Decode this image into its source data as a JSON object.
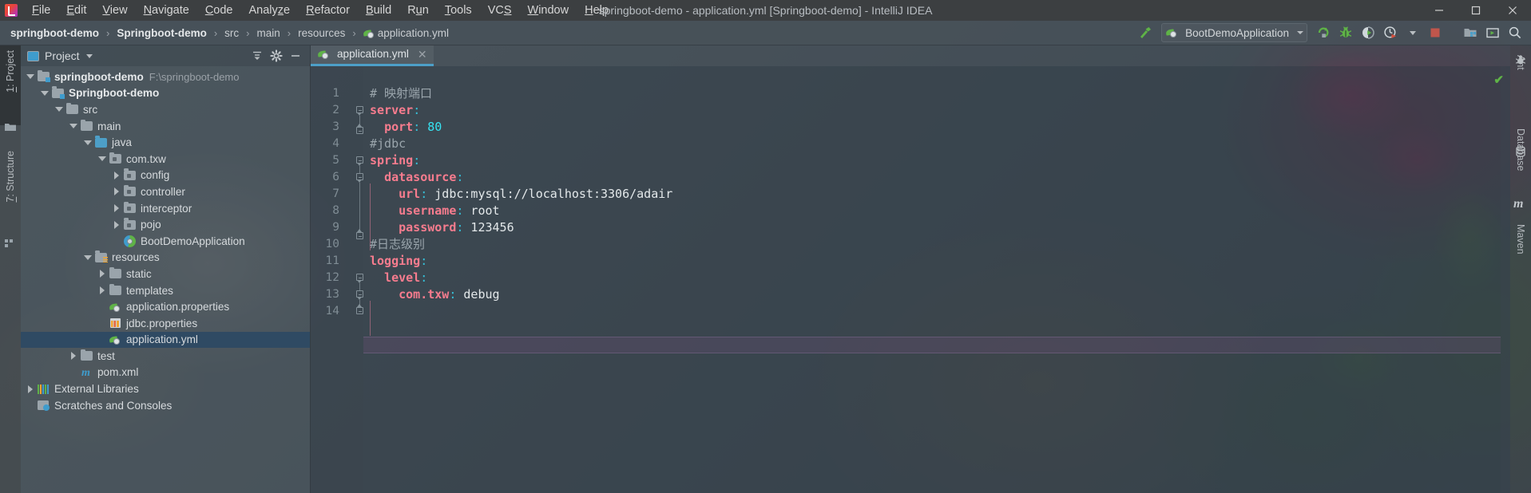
{
  "window": {
    "title": "springboot-demo - application.yml [Springboot-demo] - IntelliJ IDEA",
    "minimize_label": "─",
    "maximize_label": "❐",
    "close_label": "✕"
  },
  "menu": {
    "items": [
      {
        "label": "File",
        "mnemonic": "F"
      },
      {
        "label": "Edit",
        "mnemonic": "E"
      },
      {
        "label": "View",
        "mnemonic": "V"
      },
      {
        "label": "Navigate",
        "mnemonic": "N"
      },
      {
        "label": "Code",
        "mnemonic": "C"
      },
      {
        "label": "Analyze",
        "mnemonic": "z"
      },
      {
        "label": "Refactor",
        "mnemonic": "R"
      },
      {
        "label": "Build",
        "mnemonic": "B"
      },
      {
        "label": "Run",
        "mnemonic": "u"
      },
      {
        "label": "Tools",
        "mnemonic": "T"
      },
      {
        "label": "VCS",
        "mnemonic": "S"
      },
      {
        "label": "Window",
        "mnemonic": "W"
      },
      {
        "label": "Help",
        "mnemonic": "H"
      }
    ]
  },
  "breadcrumb": {
    "items": [
      {
        "label": "springboot-demo",
        "bold": true,
        "icon": ""
      },
      {
        "label": "Springboot-demo",
        "bold": true,
        "icon": ""
      },
      {
        "label": "src",
        "bold": false,
        "icon": ""
      },
      {
        "label": "main",
        "bold": false,
        "icon": ""
      },
      {
        "label": "resources",
        "bold": false,
        "icon": ""
      },
      {
        "label": "application.yml",
        "bold": false,
        "icon": "spring-yaml-icon"
      }
    ],
    "separator": "›"
  },
  "toolbar": {
    "build_icon": "hammer-icon",
    "run_config": {
      "name": "BootDemoApplication",
      "icon": "spring-boot-icon",
      "caret": "▾"
    },
    "buttons": [
      {
        "name": "run-button",
        "icon": "run-icon"
      },
      {
        "name": "debug-button",
        "icon": "debug-bug-icon"
      },
      {
        "name": "run-with-coverage-button",
        "icon": "coverage-icon"
      },
      {
        "name": "profiler-button",
        "icon": "profiler-clock-icon"
      },
      {
        "name": "profiler-dropdown",
        "icon": "chevron-down-icon"
      },
      {
        "name": "stop-button",
        "icon": "stop-square-icon"
      },
      {
        "name": "project-structure-button",
        "icon": "project-structure-icon"
      },
      {
        "name": "terminal-button",
        "icon": "terminal-icon"
      },
      {
        "name": "search-everywhere-button",
        "icon": "search-icon"
      }
    ]
  },
  "left_strip": {
    "tabs": [
      {
        "label": "1: Project",
        "mnemonic": "1",
        "active": true,
        "icon": "folder-icon"
      },
      {
        "label": "7: Structure",
        "mnemonic": "7",
        "active": false,
        "icon": "structure-icon"
      }
    ]
  },
  "right_strip": {
    "tabs": [
      {
        "label": "Ant",
        "icon": "ant-bug-icon"
      },
      {
        "label": "Database",
        "icon": "database-icon"
      },
      {
        "label": "Maven",
        "icon": "maven-m-icon"
      }
    ]
  },
  "project_panel": {
    "title": "Project",
    "title_caret": "▾",
    "tools": [
      {
        "name": "collapse-all-button",
        "icon": "collapse-all-icon"
      },
      {
        "name": "settings-button",
        "icon": "gear-icon"
      },
      {
        "name": "hide-panel-button",
        "icon": "minimize-icon"
      }
    ],
    "tree": [
      {
        "label": "springboot-demo",
        "path": "F:\\springboot-demo",
        "indent": 0,
        "twist": "down",
        "icon": "module-folder-icon",
        "bold": true,
        "selected": false
      },
      {
        "label": "Springboot-demo",
        "path": "",
        "indent": 1,
        "twist": "down",
        "icon": "module-folder-icon",
        "bold": true,
        "selected": false
      },
      {
        "label": "src",
        "path": "",
        "indent": 2,
        "twist": "down",
        "icon": "folder-icon",
        "bold": false,
        "selected": false
      },
      {
        "label": "main",
        "path": "",
        "indent": 3,
        "twist": "down",
        "icon": "folder-icon",
        "bold": false,
        "selected": false
      },
      {
        "label": "java",
        "path": "",
        "indent": 4,
        "twist": "down",
        "icon": "source-root-folder-icon",
        "bold": false,
        "selected": false
      },
      {
        "label": "com.txw",
        "path": "",
        "indent": 5,
        "twist": "down",
        "icon": "package-icon",
        "bold": false,
        "selected": false
      },
      {
        "label": "config",
        "path": "",
        "indent": 6,
        "twist": "right",
        "icon": "package-icon",
        "bold": false,
        "selected": false
      },
      {
        "label": "controller",
        "path": "",
        "indent": 6,
        "twist": "right",
        "icon": "package-icon",
        "bold": false,
        "selected": false
      },
      {
        "label": "interceptor",
        "path": "",
        "indent": 6,
        "twist": "right",
        "icon": "package-icon",
        "bold": false,
        "selected": false
      },
      {
        "label": "pojo",
        "path": "",
        "indent": 6,
        "twist": "right",
        "icon": "package-icon",
        "bold": false,
        "selected": false
      },
      {
        "label": "BootDemoApplication",
        "path": "",
        "indent": 6,
        "twist": "none",
        "icon": "spring-boot-class-icon",
        "bold": false,
        "selected": false
      },
      {
        "label": "resources",
        "path": "",
        "indent": 4,
        "twist": "down",
        "icon": "resource-root-folder-icon",
        "bold": false,
        "selected": false
      },
      {
        "label": "static",
        "path": "",
        "indent": 5,
        "twist": "right",
        "icon": "folder-icon",
        "bold": false,
        "selected": false
      },
      {
        "label": "templates",
        "path": "",
        "indent": 5,
        "twist": "right",
        "icon": "folder-icon",
        "bold": false,
        "selected": false
      },
      {
        "label": "application.properties",
        "path": "",
        "indent": 5,
        "twist": "none",
        "icon": "spring-properties-icon",
        "bold": false,
        "selected": false
      },
      {
        "label": "jdbc.properties",
        "path": "",
        "indent": 5,
        "twist": "none",
        "icon": "properties-icon",
        "bold": false,
        "selected": false
      },
      {
        "label": "application.yml",
        "path": "",
        "indent": 5,
        "twist": "none",
        "icon": "spring-yaml-icon",
        "bold": false,
        "selected": true
      },
      {
        "label": "test",
        "path": "",
        "indent": 3,
        "twist": "right",
        "icon": "folder-icon",
        "bold": false,
        "selected": false
      },
      {
        "label": "pom.xml",
        "path": "",
        "indent": 3,
        "twist": "none",
        "icon": "maven-m-icon",
        "bold": false,
        "selected": false
      },
      {
        "label": "External Libraries",
        "path": "",
        "indent": 0,
        "twist": "right",
        "icon": "external-libraries-icon",
        "bold": false,
        "selected": false
      },
      {
        "label": "Scratches and Consoles",
        "path": "",
        "indent": 0,
        "twist": "none",
        "icon": "scratches-icon",
        "bold": false,
        "selected": false
      }
    ]
  },
  "editor": {
    "tab": {
      "label": "application.yml",
      "icon": "spring-yaml-icon",
      "close": "✕"
    },
    "inspection_status": "✔",
    "current_line": 14,
    "lines": [
      {
        "num": "1",
        "tokens": [
          {
            "t": "# 映射端口",
            "c": "k-com"
          }
        ]
      },
      {
        "num": "2",
        "tokens": [
          {
            "t": "server",
            "c": "k-key"
          },
          {
            "t": ":",
            "c": "k-colon"
          }
        ]
      },
      {
        "num": "3",
        "tokens": [
          {
            "t": "  ",
            "c": "k-str"
          },
          {
            "t": "port",
            "c": "k-key"
          },
          {
            "t": ":",
            "c": "k-colon"
          },
          {
            "t": " ",
            "c": "k-str"
          },
          {
            "t": "80",
            "c": "k-num"
          }
        ]
      },
      {
        "num": "4",
        "tokens": [
          {
            "t": "#jdbc",
            "c": "k-com"
          }
        ]
      },
      {
        "num": "5",
        "tokens": [
          {
            "t": "spring",
            "c": "k-key"
          },
          {
            "t": ":",
            "c": "k-colon"
          }
        ]
      },
      {
        "num": "6",
        "tokens": [
          {
            "t": "  ",
            "c": "k-str"
          },
          {
            "t": "datasource",
            "c": "k-key"
          },
          {
            "t": ":",
            "c": "k-colon"
          }
        ]
      },
      {
        "num": "7",
        "tokens": [
          {
            "t": "    ",
            "c": "k-str"
          },
          {
            "t": "url",
            "c": "k-key"
          },
          {
            "t": ":",
            "c": "k-colon"
          },
          {
            "t": " jdbc:mysql://localhost:3306/adair",
            "c": "k-str"
          }
        ]
      },
      {
        "num": "8",
        "tokens": [
          {
            "t": "    ",
            "c": "k-str"
          },
          {
            "t": "username",
            "c": "k-key"
          },
          {
            "t": ":",
            "c": "k-colon"
          },
          {
            "t": " root",
            "c": "k-str"
          }
        ]
      },
      {
        "num": "9",
        "tokens": [
          {
            "t": "    ",
            "c": "k-str"
          },
          {
            "t": "password",
            "c": "k-key"
          },
          {
            "t": ":",
            "c": "k-colon"
          },
          {
            "t": " 123456",
            "c": "k-str"
          }
        ]
      },
      {
        "num": "10",
        "tokens": [
          {
            "t": "#日志级别",
            "c": "k-com"
          }
        ]
      },
      {
        "num": "11",
        "tokens": [
          {
            "t": "logging",
            "c": "k-key"
          },
          {
            "t": ":",
            "c": "k-colon"
          }
        ]
      },
      {
        "num": "12",
        "tokens": [
          {
            "t": "  ",
            "c": "k-str"
          },
          {
            "t": "level",
            "c": "k-key"
          },
          {
            "t": ":",
            "c": "k-colon"
          }
        ]
      },
      {
        "num": "13",
        "tokens": [
          {
            "t": "    ",
            "c": "k-str"
          },
          {
            "t": "com.txw",
            "c": "k-key"
          },
          {
            "t": ":",
            "c": "k-colon"
          },
          {
            "t": " debug",
            "c": "k-str"
          }
        ]
      },
      {
        "num": "14",
        "tokens": []
      }
    ]
  },
  "colors": {
    "accent_blue": "#4d9fc8",
    "selection": "#2f4a63",
    "key_pink": "#f77c8e",
    "colon_cyan": "#36c0d8",
    "number_cyan": "#36e3f2",
    "comment_gray": "#9aa5ac",
    "run_green": "#5fb347",
    "stop_red": "#c0564c"
  }
}
